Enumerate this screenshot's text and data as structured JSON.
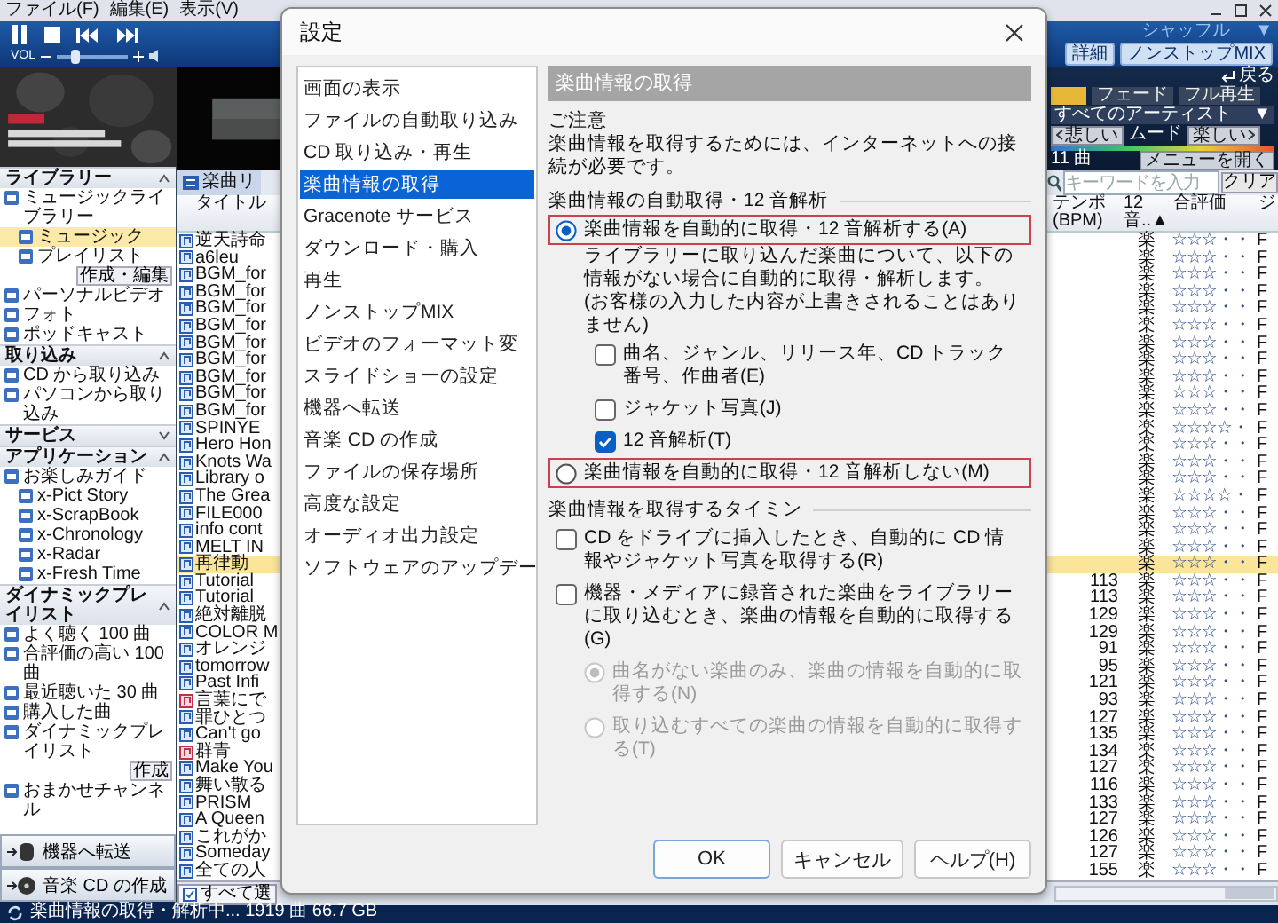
{
  "menubar": {
    "items": [
      "ファイル(F)",
      "編集(E)",
      "表示(V)"
    ]
  },
  "player": {
    "volume_label": "VOL",
    "volume": {
      "level": 0.25
    },
    "shuffle": "シャッフル",
    "shuffle_caret": "▼",
    "buttons": [
      "詳細",
      "ノンストップMIX"
    ]
  },
  "library": {
    "sections": [
      {
        "title": "ライブラリー",
        "expanded": true,
        "items": [
          {
            "label": "ミュージックライブラリー",
            "selected": false,
            "children": [
              {
                "label": "ミュージック",
                "selected": true
              },
              {
                "label": "プレイリスト",
                "selected": false,
                "action": "作成・編集"
              }
            ]
          },
          {
            "label": "パーソナルビデオ",
            "selected": false
          },
          {
            "label": "フォト",
            "selected": false
          },
          {
            "label": "ポッドキャスト",
            "selected": false
          }
        ]
      },
      {
        "title": "取り込み",
        "expanded": true,
        "items": [
          {
            "label": "CD から取り込み",
            "selected": false
          },
          {
            "label": "パソコンから取り込み",
            "selected": false
          }
        ]
      },
      {
        "title": "サービス",
        "expanded": false
      },
      {
        "title": "アプリケーション",
        "expanded": true,
        "items": [
          {
            "label": "お楽しみガイド",
            "selected": false,
            "children": [
              {
                "label": "x-Pict Story",
                "selected": false
              },
              {
                "label": "x-ScrapBook",
                "selected": false
              },
              {
                "label": "x-Chronology",
                "selected": false
              },
              {
                "label": "x-Radar",
                "selected": false
              },
              {
                "label": "x-Fresh Time",
                "selected": false
              }
            ]
          }
        ]
      },
      {
        "title": "ダイナミックプレイリスト",
        "expanded": true,
        "items": [
          {
            "label": "よく聴く 100 曲",
            "selected": false
          },
          {
            "label": "合評価の高い 100 曲",
            "selected": false
          },
          {
            "label": "最近聴いた 30 曲",
            "selected": false
          },
          {
            "label": "購入した曲",
            "selected": false
          },
          {
            "label": "ダイナミックプレイリスト",
            "selected": false,
            "action": "作成"
          },
          {
            "label": "おまかせチャンネル",
            "selected": false
          }
        ]
      }
    ],
    "buttons": [
      "機器へ転送",
      "音楽 CD の作成"
    ]
  },
  "nonstop": {
    "back": "戻る",
    "tabs": [
      {
        "selected": true
      },
      {
        "label": "フェード",
        "selected": false
      },
      {
        "label": "フル再生",
        "selected": false
      }
    ],
    "artist": "すべてのアーティスト",
    "artist_caret": "▼",
    "mood_left": "悲しい",
    "mood_label": "ムード",
    "mood_right": "楽しい",
    "count": "11 曲",
    "menu_button": "メニューを開く"
  },
  "tracks": {
    "tab": "楽曲リ",
    "search": {
      "placeholder": "キーワードを入力"
    },
    "clear": "クリア",
    "columns": [
      "タイトル",
      "テンポ (BPM)",
      "12 音..▲",
      "合評価",
      "ジ"
    ],
    "rows": [
      {
        "title": "逆天詩命",
        "kind": "standard",
        "selected": false,
        "key": "楽",
        "rating": "☆☆☆・・",
        "column_4": "F"
      },
      {
        "title": "a6leu",
        "kind": "standard",
        "selected": false,
        "key": "楽",
        "rating": "☆☆☆・・",
        "column_4": "F"
      },
      {
        "title": "BGM_for",
        "kind": "standard",
        "selected": false,
        "key": "楽",
        "rating": "☆☆☆・・",
        "column_4": "F"
      },
      {
        "title": "BGM_for",
        "kind": "standard",
        "selected": false,
        "key": "楽",
        "rating": "☆☆☆・・",
        "column_4": "F"
      },
      {
        "title": "BGM_for",
        "kind": "standard",
        "selected": false,
        "key": "楽",
        "rating": "☆☆☆・・",
        "column_4": "F"
      },
      {
        "title": "BGM_for",
        "kind": "standard",
        "selected": false,
        "key": "楽",
        "rating": "☆☆☆・・",
        "column_4": "F"
      },
      {
        "title": "BGM_for",
        "kind": "standard",
        "selected": false,
        "key": "楽",
        "rating": "☆☆☆・・",
        "column_4": "F"
      },
      {
        "title": "BGM_for",
        "kind": "standard",
        "selected": false,
        "key": "楽",
        "rating": "☆☆☆・・",
        "column_4": "F"
      },
      {
        "title": "BGM_for",
        "kind": "standard",
        "selected": false,
        "key": "楽",
        "rating": "☆☆☆・・",
        "column_4": "F"
      },
      {
        "title": "BGM_for",
        "kind": "standard",
        "selected": false,
        "key": "楽",
        "rating": "☆☆☆・・",
        "column_4": "F"
      },
      {
        "title": "BGM_for",
        "kind": "standard",
        "selected": false,
        "key": "楽",
        "rating": "☆☆☆・・",
        "column_4": "F"
      },
      {
        "title": "SPINYE",
        "kind": "standard",
        "selected": false,
        "key": "楽",
        "rating": "☆☆☆☆・",
        "column_4": "F"
      },
      {
        "title": "Hero Hon",
        "kind": "standard",
        "selected": false,
        "key": "楽",
        "rating": "☆☆☆・・",
        "column_4": "F"
      },
      {
        "title": "Knots Wa",
        "kind": "standard",
        "selected": false,
        "key": "楽",
        "rating": "☆☆☆・・",
        "column_4": "F"
      },
      {
        "title": "Library o",
        "kind": "standard",
        "selected": false,
        "key": "楽",
        "rating": "☆☆☆・・",
        "column_4": "F"
      },
      {
        "title": "The Grea",
        "kind": "standard",
        "selected": false,
        "key": "楽",
        "rating": "☆☆☆☆・",
        "column_4": "F"
      },
      {
        "title": "FILE000",
        "kind": "standard",
        "selected": false,
        "key": "楽",
        "rating": "☆☆☆・・",
        "column_4": "F"
      },
      {
        "title": "info cont",
        "kind": "standard",
        "selected": false,
        "key": "楽",
        "rating": "☆☆☆・・",
        "column_4": "F"
      },
      {
        "title": "MELT IN",
        "kind": "standard",
        "selected": false,
        "key": "楽",
        "rating": "☆☆☆・・",
        "column_4": "F"
      },
      {
        "title": "再律動",
        "kind": "standard",
        "selected": true,
        "key": "楽",
        "rating": "☆☆☆・・",
        "column_4": "F"
      },
      {
        "title": "Tutorial",
        "kind": "standard",
        "selected": false,
        "bpm": "113",
        "key": "楽",
        "rating": "☆☆☆・・",
        "column_4": "F"
      },
      {
        "title": "Tutorial",
        "kind": "standard",
        "selected": false,
        "bpm": "113",
        "key": "楽",
        "rating": "☆☆☆・・",
        "column_4": "F"
      },
      {
        "title": "絶対離脱",
        "kind": "standard",
        "selected": false,
        "bpm": "129",
        "key": "楽",
        "rating": "☆☆☆・・",
        "column_4": "F"
      },
      {
        "title": "COLOR M",
        "kind": "standard",
        "selected": false,
        "bpm": "129",
        "key": "楽",
        "rating": "☆☆☆・・",
        "column_4": "F"
      },
      {
        "title": "オレンジ",
        "kind": "standard",
        "selected": false,
        "bpm": "91",
        "key": "楽",
        "rating": "☆☆☆・・",
        "column_4": "F"
      },
      {
        "title": "tomorrow",
        "kind": "standard",
        "selected": false,
        "bpm": "95",
        "key": "楽",
        "rating": "☆☆☆・・",
        "column_4": "F"
      },
      {
        "title": "Past Infi",
        "kind": "standard",
        "selected": false,
        "bpm": "121",
        "key": "楽",
        "rating": "☆☆☆・・",
        "column_4": "F"
      },
      {
        "title": "言葉にで",
        "kind": "marked",
        "selected": false,
        "bpm": "93",
        "key": "楽",
        "rating": "☆☆☆・・",
        "column_4": "F"
      },
      {
        "title": "罪ひとつ",
        "kind": "standard",
        "selected": false,
        "bpm": "127",
        "key": "楽",
        "rating": "☆☆☆・・",
        "column_4": "F"
      },
      {
        "title": "Can't go",
        "kind": "standard",
        "selected": false,
        "bpm": "135",
        "key": "楽",
        "rating": "☆☆☆・・",
        "column_4": "F"
      },
      {
        "title": "群青",
        "kind": "marked",
        "selected": false,
        "bpm": "134",
        "key": "楽",
        "rating": "☆☆☆・・",
        "column_4": "F"
      },
      {
        "title": "Make You",
        "kind": "standard",
        "selected": false,
        "bpm": "127",
        "key": "楽",
        "rating": "☆☆☆・・",
        "column_4": "F"
      },
      {
        "title": "舞い散る",
        "kind": "standard",
        "selected": false,
        "bpm": "116",
        "key": "楽",
        "rating": "☆☆☆・・",
        "column_4": "F"
      },
      {
        "title": "PRISM",
        "kind": "standard",
        "selected": false,
        "bpm": "133",
        "key": "楽",
        "rating": "☆☆☆・・",
        "column_4": "F"
      },
      {
        "title": "A Queen",
        "kind": "standard",
        "selected": false,
        "bpm": "127",
        "key": "楽",
        "rating": "☆☆☆・・",
        "column_4": "F"
      },
      {
        "title": "これがか",
        "kind": "standard",
        "selected": false,
        "bpm": "126",
        "key": "楽",
        "rating": "☆☆☆・・",
        "column_4": "F"
      },
      {
        "title": "Someday",
        "kind": "standard",
        "selected": false,
        "bpm": "127",
        "key": "楽",
        "rating": "☆☆☆・・",
        "column_4": "F"
      },
      {
        "title": "全ての人",
        "kind": "standard",
        "selected": false,
        "bpm": "155",
        "key": "楽",
        "rating": "☆☆☆・・",
        "column_4": "F"
      }
    ],
    "select_all": "すべて選"
  },
  "status_bar": "楽曲情報の取得・解析中... 1919 曲 66.7 GB",
  "dialog": {
    "title": "設定",
    "nav": [
      {
        "label": "画面の表示",
        "selected": false
      },
      {
        "label": "ファイルの自動取り込み",
        "selected": false
      },
      {
        "label": "CD 取り込み・再生",
        "selected": false
      },
      {
        "label": "楽曲情報の取得",
        "selected": true
      },
      {
        "label": "Gracenote サービス",
        "selected": false
      },
      {
        "label": "ダウンロード・購入",
        "selected": false
      },
      {
        "label": "再生",
        "selected": false
      },
      {
        "label": "ノンストップMIX",
        "selected": false
      },
      {
        "label": "ビデオのフォーマット変",
        "selected": false
      },
      {
        "label": "スライドショーの設定",
        "selected": false
      },
      {
        "label": "機器へ転送",
        "selected": false
      },
      {
        "label": "音楽 CD の作成",
        "selected": false
      },
      {
        "label": "ファイルの保存場所",
        "selected": false
      },
      {
        "label": "高度な設定",
        "selected": false
      },
      {
        "label": "オーディオ出力設定",
        "selected": false
      },
      {
        "label": "ソフトウェアのアップデー",
        "selected": false
      }
    ],
    "section_title": "楽曲情報の取得",
    "notice_label": "ご注意",
    "notice": "楽曲情報を取得するためには、インターネットへの接続が必要です。",
    "groups": [
      {
        "title": "楽曲情報の自動取得・12 音解析",
        "controls": [
          {
            "kind": "radio",
            "label": "楽曲情報を自動的に取得・12 音解析する(A)",
            "selected": true,
            "outlined": true,
            "disabled": false,
            "notes": [
              "ライブラリーに取り込んだ楽曲について、以下の情報がない場合に自動的に取得・解析します。",
              "(お客様の入力した内容が上書きされることはありません)"
            ],
            "children": [
              {
                "kind": "checkbox",
                "label": "曲名、ジャンル、リリース年、CD トラック番号、作曲者(E)",
                "checked": false,
                "disabled": false
              },
              {
                "kind": "checkbox",
                "label": "ジャケット写真(J)",
                "checked": false,
                "disabled": false
              },
              {
                "kind": "checkbox",
                "label": "12 音解析(T)",
                "checked": true,
                "disabled": false
              }
            ]
          },
          {
            "kind": "radio",
            "label": "楽曲情報を自動的に取得・12 音解析しない(M)",
            "selected": false,
            "outlined": true,
            "disabled": false
          }
        ]
      },
      {
        "title": "楽曲情報を取得するタイミン",
        "controls": [
          {
            "kind": "checkbox",
            "label": "CD をドライブに挿入したとき、自動的に CD 情報やジャケット写真を取得する(R)",
            "checked": false,
            "disabled": false
          },
          {
            "kind": "checkbox",
            "label": "機器・メディアに録音された楽曲をライブラリーに取り込むとき、楽曲の情報を自動的に取得する(G)",
            "checked": false,
            "disabled": false,
            "children": [
              {
                "kind": "radio",
                "label": "曲名がない楽曲のみ、楽曲の情報を自動的に取得する(N)",
                "selected": true,
                "outlined": false,
                "disabled": true
              },
              {
                "kind": "radio",
                "label": "取り込むすべての楽曲の情報を自動的に取得する(T)",
                "selected": false,
                "outlined": false,
                "disabled": true
              }
            ]
          }
        ]
      }
    ],
    "buttons": [
      {
        "label": "OK",
        "default": true
      },
      {
        "label": "キャンセル",
        "default": false
      },
      {
        "label": "ヘルプ(H)",
        "default": false
      }
    ]
  }
}
